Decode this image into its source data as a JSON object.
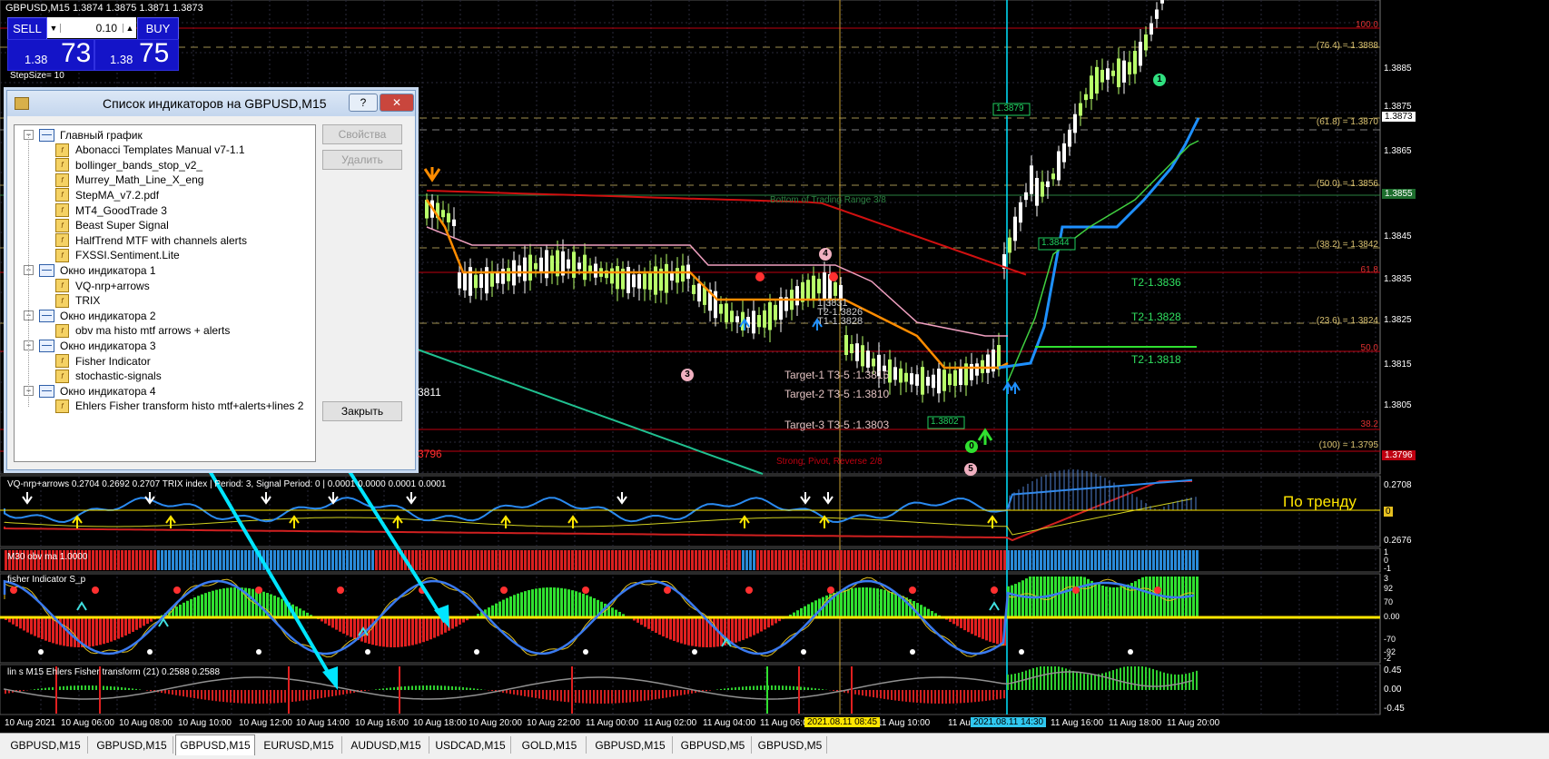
{
  "trade_panel": {
    "symbol_title": "GBPUSD,M15  1.3874 1.3875 1.3871 1.3873",
    "sell_label": "SELL",
    "buy_label": "BUY",
    "lot_value": "0.10",
    "sell_price_small": "1.38",
    "sell_price_big": "73",
    "buy_price_small": "1.38",
    "buy_price_big": "75",
    "step_size": "StepSize= 10"
  },
  "dialog": {
    "title": "Список индикаторов на GBPUSD,M15",
    "help_label": "?",
    "close_x_label": "✕",
    "properties_label": "Свойства",
    "delete_label": "Удалить",
    "close_label": "Закрыть",
    "tree": [
      {
        "label": "Главный график",
        "kind": "window",
        "level": 0
      },
      {
        "label": "Abonacci Templates Manual v7-1.1",
        "kind": "indicator",
        "level": 1
      },
      {
        "label": "bollinger_bands_stop_v2_",
        "kind": "indicator",
        "level": 1
      },
      {
        "label": "Murrey_Math_Line_X_eng",
        "kind": "indicator",
        "level": 1
      },
      {
        "label": "StepMA_v7.2.pdf",
        "kind": "indicator",
        "level": 1
      },
      {
        "label": "MT4_GoodTrade 3",
        "kind": "indicator",
        "level": 1
      },
      {
        "label": "Beast Super Signal",
        "kind": "indicator",
        "level": 1
      },
      {
        "label": "HalfTrend MTF with channels alerts",
        "kind": "indicator",
        "level": 1
      },
      {
        "label": "FXSSI.Sentiment.Lite",
        "kind": "indicator",
        "level": 1
      },
      {
        "label": "Окно индикатора 1",
        "kind": "window",
        "level": 0
      },
      {
        "label": "VQ-nrp+arrows",
        "kind": "indicator",
        "level": 1
      },
      {
        "label": "TRIX",
        "kind": "indicator",
        "level": 1
      },
      {
        "label": "Окно индикатора 2",
        "kind": "window",
        "level": 0
      },
      {
        "label": "obv ma histo mtf arrows + alerts",
        "kind": "indicator",
        "level": 1
      },
      {
        "label": "Окно индикатора 3",
        "kind": "window",
        "level": 0
      },
      {
        "label": "Fisher Indicator",
        "kind": "indicator",
        "level": 1
      },
      {
        "label": "stochastic-signals",
        "kind": "indicator",
        "level": 1
      },
      {
        "label": "Окно индикатора 4",
        "kind": "window",
        "level": 0
      },
      {
        "label": "Ehlers Fisher transform histo mtf+alerts+lines 2",
        "kind": "indicator",
        "level": 1
      }
    ]
  },
  "main_chart": {
    "right_axis": [
      "1.3885",
      "1.3875",
      "1.3865",
      "1.3845",
      "1.3835",
      "1.3825",
      "1.3815",
      "1.3805"
    ],
    "current_price": "1.3873",
    "price_tag_2": "1.3855",
    "price_tag_3": "1.3796",
    "fib_labels": [
      {
        "text": "100.0",
        "color": "#e03030"
      },
      {
        "text": "(76.4) = 1.3888",
        "color": "#d8c070"
      },
      {
        "text": "(61.8) = 1.3870",
        "color": "#d8c070"
      },
      {
        "text": "(50.0) = 1.3856",
        "color": "#d8c070"
      },
      {
        "text": "(38.2) = 1.3842",
        "color": "#d8c070"
      },
      {
        "text": "61.8",
        "color": "#e03030"
      },
      {
        "text": "(23.6) = 1.3824",
        "color": "#d8c070"
      },
      {
        "text": "50.0",
        "color": "#e03030"
      },
      {
        "text": "38.2",
        "color": "#e03030"
      },
      {
        "text": "(100) = 1.3795",
        "color": "#d8c070"
      }
    ],
    "left_labels": {
      "l1": "3811",
      "l2": "3796"
    },
    "box_labels": {
      "b1": "1.3879",
      "b2": "1.3844",
      "b3": "1.3802"
    },
    "trading_range": "Bottom of Trading Range  3/8",
    "strong_pivot": "Strong, Pivot, Reverse  2/8",
    "targets": [
      "Target-1 T3-5 :1.3815",
      "Target-2 T3-5 :1.3810",
      "Target-3 T3-5 :1.3803"
    ],
    "t2_labels": [
      "T2-1.3836",
      "T2-1.3828",
      "T2-1.3818"
    ],
    "small_labels": [
      "1.3831",
      "T2-1.3826",
      "T1-1.3828"
    ],
    "circle_labels": {
      "c1": "1",
      "c3": "3",
      "c4": "4",
      "c0": "0",
      "c5": "5"
    }
  },
  "panes": {
    "vq_title": "VQ-nrp+arrows 0.2704 0.2692 0.2707  TRIX index | Period: 3, Signal Period: 0 |  0.0001 0.0000 0.0001 0.0001",
    "vq_axis": [
      "0.2708",
      "0",
      "0.2676"
    ],
    "po_trendu": "По тренду",
    "obv_title": "M30 obv ma 1.0000",
    "obv_axis": [
      "1",
      "0",
      "-1"
    ],
    "fisher_title": "fisher Indicator  S_p",
    "fisher_axis": [
      "92",
      "70",
      "0.00",
      "-70",
      "-92"
    ],
    "fisher_axis_top": "3",
    "fisher_axis_bottom": "-2",
    "ehlers_title": "lin s M15 Ehlers  Fisher transform (21) 0.2588 0.2588",
    "ehlers_axis": [
      "0.45",
      "0.00",
      "-0.45"
    ]
  },
  "time_axis": {
    "labels": [
      "10 Aug 2021",
      "10 Aug 06:00",
      "10 Aug 08:00",
      "10 Aug 10:00",
      "10 Aug 12:00",
      "10 Aug 14:00",
      "10 Aug 16:00",
      "10 Aug 18:00",
      "10 Aug 20:00",
      "10 Aug 22:00",
      "11 Aug 00:00",
      "11 Aug 02:00",
      "11 Aug 04:00",
      "11 Aug 06:0",
      "11 Aug 10:00",
      "11 Aug 12",
      "11 Aug 16:00",
      "11 Aug 18:00",
      "11 Aug 20:00"
    ],
    "highlight_1": "2021.08.11 08:45",
    "highlight_2": "2021.08.11 14:30"
  },
  "tabs": [
    "GBPUSD,M15",
    "GBPUSD,M15",
    "GBPUSD,M15",
    "EURUSD,M15",
    "AUDUSD,M15",
    "USDCAD,M15",
    "GOLD,M15",
    "GBPUSD,M15",
    "GBPUSD,M5",
    "GBPUSD,M5"
  ],
  "active_tab": 2,
  "colors": {
    "background": "#000000",
    "grid": "#2a2a3a",
    "bull": "#b8ff6a",
    "bear": "#ffffff",
    "red": "#e01010",
    "blue": "#1e90ff",
    "orange": "#ff8c00",
    "cyan": "#00e5ff",
    "accent_yellow": "#ffe600"
  }
}
